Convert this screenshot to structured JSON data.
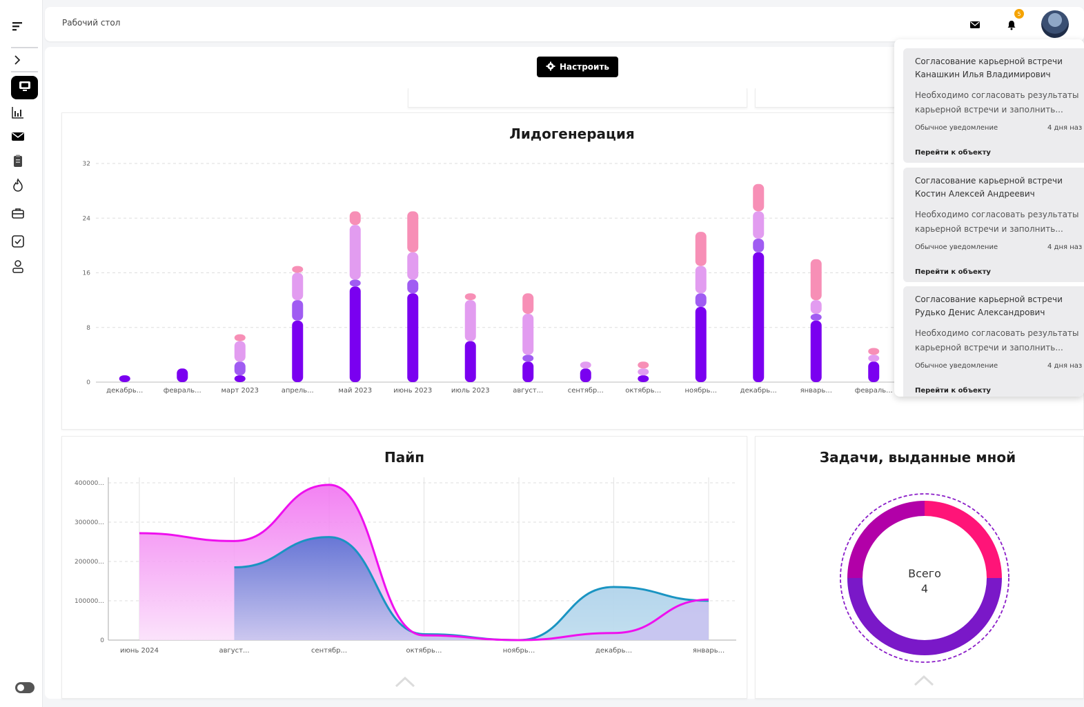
{
  "topbar": {
    "title": "Рабочий стол",
    "notification_count": "5"
  },
  "toolbar": {
    "configure_label": "Настроить"
  },
  "lead_chart": {
    "title": "Лидогенерация"
  },
  "pipe_chart": {
    "title": "Пайп"
  },
  "tasks_chart": {
    "title": "Задачи, выданные мной",
    "center_label": "Всего",
    "center_value": "4"
  },
  "notifications": [
    {
      "title_line1": "Согласование карьерной встречи",
      "title_line2": "Канашкин Илья Владимирович",
      "body_line1": "Необходимо согласовать результаты",
      "body_line2": "карьерной встречи и заполнить...",
      "type": "Обычное уведомление",
      "time": "4 дня наз",
      "link": "Перейти к объекту"
    },
    {
      "title_line1": "Согласование карьерной встречи",
      "title_line2": "Костин Алексей Андреевич",
      "body_line1": "Необходимо согласовать результаты",
      "body_line2": "карьерной встречи и заполнить...",
      "type": "Обычное уведомление",
      "time": "4 дня наз",
      "link": "Перейти к объекту"
    },
    {
      "title_line1": "Согласование карьерной встречи",
      "title_line2": "Рудько Денис Александрович",
      "body_line1": "Необходимо согласовать результаты",
      "body_line2": "карьерной встречи и заполнить...",
      "type": "Обычное уведомление",
      "time": "4 дня наз",
      "link": "Перейти к объекту"
    }
  ],
  "sidebar": {
    "icons": [
      "menu-icon",
      "chevron-right-icon",
      "desktop-icon",
      "bar-chart-icon",
      "mail-icon",
      "clipboard-icon",
      "fire-icon",
      "briefcase-icon",
      "checkbox-icon",
      "user-icon"
    ]
  },
  "colors": {
    "purple": "#7a00f0",
    "violet": "#a05cf2",
    "lilac": "#e29cf0",
    "pink": "#f78fb6",
    "magenta": "#ee10ee",
    "teal": "#1a94c2",
    "donut_pink": "#ff1478",
    "donut_magenta": "#b200a8",
    "donut_purple": "#7a18c8"
  },
  "chart_data": [
    {
      "type": "bar",
      "title": "Лидогенерация",
      "categories": [
        "декабрь...",
        "февраль...",
        "март 2023",
        "апрель...",
        "май 2023",
        "июнь 2023",
        "июль 2023",
        "август...",
        "сентябр...",
        "октябрь...",
        "ноябрь...",
        "декабрь...",
        "январь...",
        "февраль..."
      ],
      "yticks": [
        0,
        8,
        16,
        24,
        32
      ],
      "ylim": [
        0,
        32
      ],
      "grid": true,
      "stacked": true,
      "series": [
        {
          "values": [
            1,
            2,
            1,
            9,
            14,
            13,
            6,
            3,
            2,
            1,
            11,
            19,
            9,
            3
          ]
        },
        {
          "values": [
            0,
            0,
            2,
            3,
            1,
            2,
            0,
            1,
            0,
            0,
            2,
            2,
            1,
            0
          ]
        },
        {
          "values": [
            0,
            0,
            3,
            4,
            8,
            4,
            6,
            6,
            1,
            1,
            4,
            4,
            2,
            1
          ]
        },
        {
          "values": [
            0,
            0,
            1,
            1,
            2,
            6,
            1,
            3,
            0,
            1,
            5,
            4,
            6,
            1
          ]
        }
      ]
    },
    {
      "type": "area",
      "title": "Пайп",
      "categories": [
        "июнь 2024",
        "август...",
        "сентябр...",
        "октябрь...",
        "ноябрь...",
        "декабрь...",
        "январь..."
      ],
      "yticks": [
        "0",
        "100000...",
        "200000...",
        "300000...",
        "400000..."
      ],
      "ylim": [
        0,
        400000
      ],
      "grid": true,
      "series": [
        {
          "values": [
            272000,
            252000,
            395000,
            12000,
            0,
            18000,
            103000
          ]
        },
        {
          "values": [
            null,
            185000,
            262000,
            15000,
            0,
            135000,
            100000
          ]
        }
      ]
    },
    {
      "type": "pie",
      "title": "Задачи, выданные мной",
      "values": [
        1,
        1,
        1,
        1
      ],
      "total": 4
    }
  ]
}
